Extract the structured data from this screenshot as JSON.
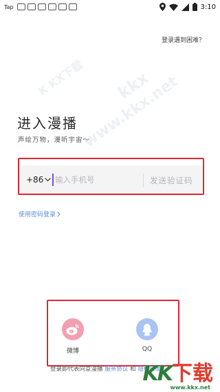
{
  "status_bar": {
    "tap_label": "Tap",
    "time": "3:10"
  },
  "header": {
    "help_link": "登录遇到困难？"
  },
  "main": {
    "title": "进入漫播",
    "subtitle": "声绘万物，漫听宇宙～"
  },
  "phone_form": {
    "country_code": "+86",
    "phone_placeholder": "输入手机号",
    "send_code_label": "发送验证码"
  },
  "password_login": {
    "label": "使用密码登录"
  },
  "social_login": {
    "weibo_label": "微博",
    "qq_label": "QQ"
  },
  "agreement": {
    "prefix": "登录即代表同意漫播",
    "service_link": "服务协议",
    "conjunction": "和",
    "privacy_link": "隐私政策"
  },
  "watermark": {
    "logo_text_1": "KK",
    "logo_text_2": "下载",
    "url": "www.kkx.net"
  },
  "colors": {
    "highlight_red": "#e0262f",
    "link_blue": "#5b8fd8",
    "weibo_pink": "#f29fb0",
    "qq_blue": "#a9c4f2",
    "caret_purple": "#7a4be0"
  }
}
